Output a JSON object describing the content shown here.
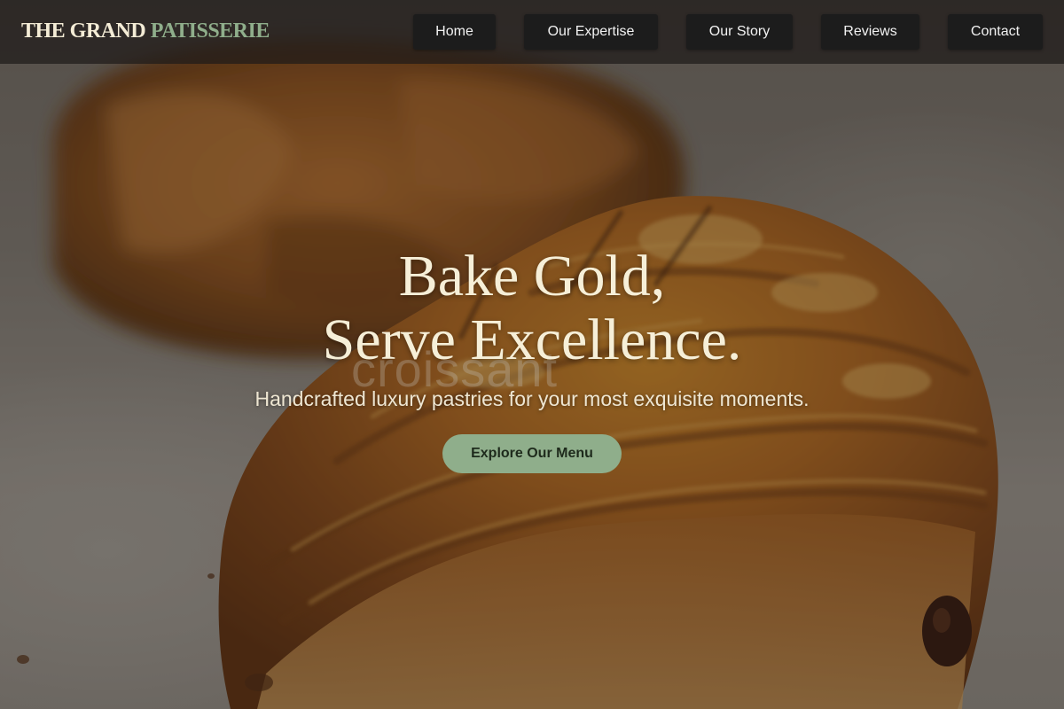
{
  "brand": {
    "name_main": "THE GRAND",
    "name_accent": "PATISSERIE"
  },
  "nav": {
    "items": [
      {
        "label": "Home"
      },
      {
        "label": "Our Expertise"
      },
      {
        "label": "Our Story"
      },
      {
        "label": "Reviews"
      },
      {
        "label": "Contact"
      }
    ]
  },
  "hero": {
    "watermark": "croissant",
    "headline_line1": "Bake Gold,",
    "headline_line2": "Serve Excellence.",
    "tagline": "Handcrafted luxury pastries for your most exquisite moments.",
    "cta_label": "Explore Our Menu",
    "image_subject": "pain-au-chocolat-photo"
  },
  "colors": {
    "accent_green": "#8fae8b",
    "cream_text": "#f6efd8",
    "nav_button_bg": "#1c1c1c",
    "navbar_bg": "#1e1b19"
  }
}
